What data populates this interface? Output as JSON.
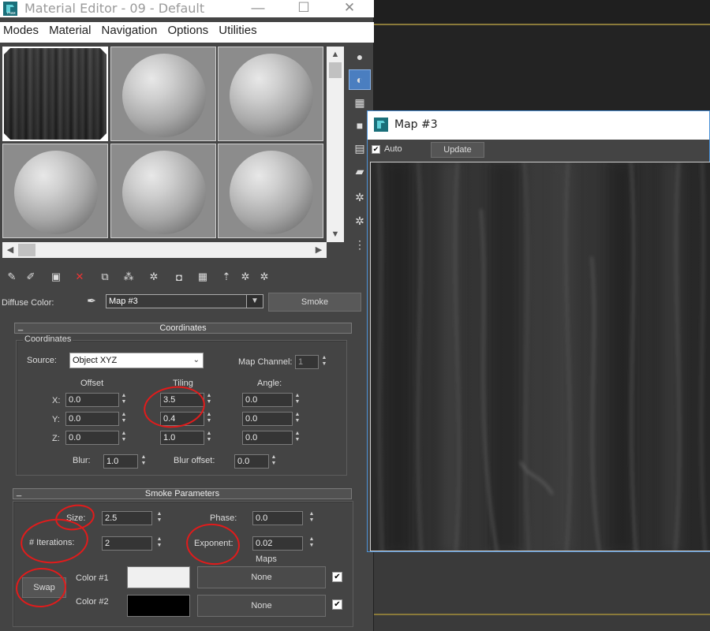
{
  "editor": {
    "title": "Material Editor - 09 - Default",
    "menu": [
      "Modes",
      "Material",
      "Navigation",
      "Options",
      "Utilities"
    ],
    "diffuse_label": "Diffuse Color:",
    "map_name": "Map #3",
    "map_type": "Smoke"
  },
  "coordinates": {
    "rollout_title": "Coordinates",
    "group_title": "Coordinates",
    "source_label": "Source:",
    "source_value": "Object XYZ",
    "map_channel_label": "Map Channel:",
    "map_channel_value": "1",
    "col_offset": "Offset",
    "col_tiling": "Tiling",
    "col_angle": "Angle:",
    "rows": [
      {
        "axis": "X:",
        "offset": "0.0",
        "tiling": "3.5",
        "angle": "0.0"
      },
      {
        "axis": "Y:",
        "offset": "0.0",
        "tiling": "0.4",
        "angle": "0.0"
      },
      {
        "axis": "Z:",
        "offset": "0.0",
        "tiling": "1.0",
        "angle": "0.0"
      }
    ],
    "blur_label": "Blur:",
    "blur_value": "1.0",
    "blur_offset_label": "Blur offset:",
    "blur_offset_value": "0.0"
  },
  "smoke": {
    "rollout_title": "Smoke Parameters",
    "size_label": "Size:",
    "size_value": "2.5",
    "phase_label": "Phase:",
    "phase_value": "0.0",
    "iterations_label": "# Iterations:",
    "iterations_value": "2",
    "exponent_label": "Exponent:",
    "exponent_value": "0.02",
    "maps_label": "Maps",
    "swap_label": "Swap",
    "color1_label": "Color #1",
    "color2_label": "Color #2",
    "color1": "#f0f0f0",
    "color2": "#000000",
    "map1_label": "None",
    "map2_label": "None"
  },
  "map_window": {
    "title": "Map #3",
    "auto_label": "Auto",
    "update_label": "Update"
  },
  "colors": {
    "accent_blue": "#4a7ec0",
    "annotation_red": "#e21b1b"
  }
}
